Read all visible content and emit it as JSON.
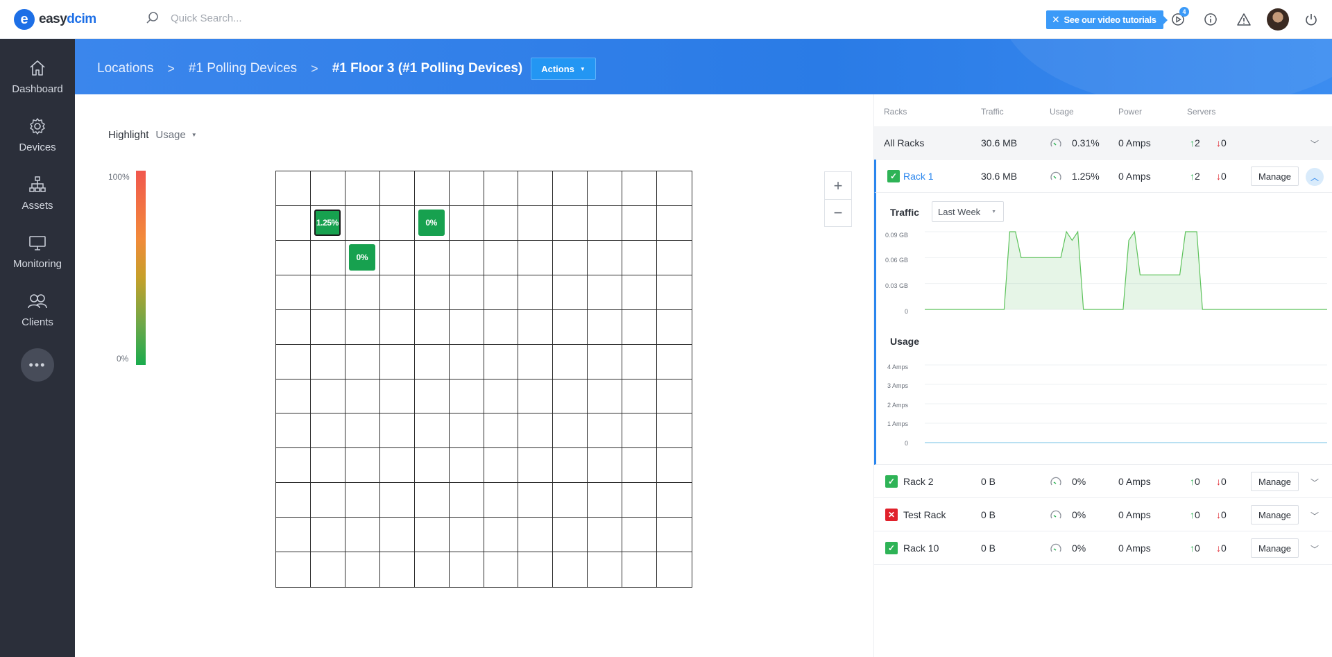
{
  "app": {
    "logo_letter": "e",
    "logo_text_a": "easy",
    "logo_text_b": "dcim"
  },
  "topbar": {
    "search_placeholder": "Quick Search...",
    "tutorials_label": "See our video tutorials",
    "notification_count": "4"
  },
  "sidebar": {
    "items": [
      {
        "label": "Dashboard",
        "icon": "home-icon"
      },
      {
        "label": "Devices",
        "icon": "gear-icon"
      },
      {
        "label": "Assets",
        "icon": "hierarchy-icon"
      },
      {
        "label": "Monitoring",
        "icon": "monitor-icon"
      },
      {
        "label": "Clients",
        "icon": "users-icon"
      }
    ],
    "more_label": "•••"
  },
  "breadcrumb": {
    "items": [
      "Locations",
      "#1 Polling Devices",
      "#1 Floor 3 (#1 Polling Devices)"
    ],
    "separator": ">",
    "actions_label": "Actions"
  },
  "highlight": {
    "label": "Highlight",
    "value": "Usage"
  },
  "legend": {
    "max": "100%",
    "min": "0%"
  },
  "floor_grid": {
    "rows": 12,
    "cols": 12,
    "racks": [
      {
        "row": 1,
        "col": 1,
        "label": "1.25%",
        "selected": true
      },
      {
        "row": 1,
        "col": 4,
        "label": "0%",
        "selected": false
      },
      {
        "row": 2,
        "col": 2,
        "label": "0%",
        "selected": false
      }
    ]
  },
  "zoom": {
    "in": "+",
    "out": "−"
  },
  "racks_table": {
    "headers": [
      "Racks",
      "Traffic",
      "Usage",
      "Power",
      "Servers"
    ],
    "all": {
      "name": "All Racks",
      "traffic": "30.6 MB",
      "usage": "0.31%",
      "power": "0 Amps",
      "up": "2",
      "down": "0"
    },
    "rows": [
      {
        "name": "Rack 1",
        "traffic": "30.6 MB",
        "usage": "1.25%",
        "power": "0 Amps",
        "up": "2",
        "down": "0",
        "status": "ok",
        "manage": "Manage"
      },
      {
        "name": "Rack 2",
        "traffic": "0 B",
        "usage": "0%",
        "power": "0 Amps",
        "up": "0",
        "down": "0",
        "status": "ok",
        "manage": "Manage"
      },
      {
        "name": "Test Rack",
        "traffic": "0 B",
        "usage": "0%",
        "power": "0 Amps",
        "up": "0",
        "down": "0",
        "status": "bad",
        "manage": "Manage"
      },
      {
        "name": "Rack 10",
        "traffic": "0 B",
        "usage": "0%",
        "power": "0 Amps",
        "up": "0",
        "down": "0",
        "status": "ok",
        "manage": "Manage"
      }
    ]
  },
  "rack_detail": {
    "traffic_title": "Traffic",
    "period": "Last Week",
    "traffic_ticks": [
      "0.09 GB",
      "0.06 GB",
      "0.03 GB",
      "0"
    ],
    "usage_title": "Usage",
    "usage_ticks": [
      "4 Amps",
      "3 Amps",
      "2 Amps",
      "1 Amps",
      "0"
    ]
  },
  "chart_data": [
    {
      "type": "area",
      "title": "Traffic",
      "ylabel": "",
      "ylim": [
        0,
        0.09
      ],
      "unit": "GB",
      "series": [
        {
          "values": [
            0,
            0,
            0,
            0,
            0,
            0,
            0,
            0,
            0,
            0,
            0,
            0,
            0,
            0,
            0,
            0.09,
            0.09,
            0.06,
            0.06,
            0.06,
            0.06,
            0.06,
            0.06,
            0.06,
            0.06,
            0.09,
            0.08,
            0.09,
            0,
            0,
            0,
            0,
            0,
            0,
            0,
            0,
            0.08,
            0.09,
            0.04,
            0.04,
            0.04,
            0.04,
            0.04,
            0.04,
            0.04,
            0.04,
            0.09,
            0.09,
            0.09,
            0,
            0,
            0,
            0,
            0,
            0,
            0,
            0,
            0,
            0,
            0,
            0,
            0,
            0,
            0,
            0,
            0,
            0,
            0,
            0,
            0,
            0,
            0
          ]
        }
      ]
    },
    {
      "type": "line",
      "title": "Usage",
      "ylim": [
        0,
        4
      ],
      "unit": "Amps",
      "series": [
        {
          "values": [
            0,
            0,
            0,
            0,
            0,
            0,
            0,
            0,
            0,
            0,
            0,
            0,
            0,
            0,
            0,
            0,
            0,
            0,
            0,
            0
          ]
        }
      ]
    }
  ],
  "colors": {
    "accent": "#2a86ee",
    "ok": "#2eb356",
    "bad": "#e0212b",
    "tile": "#17a14f",
    "sidebar": "#2b2f3a"
  }
}
